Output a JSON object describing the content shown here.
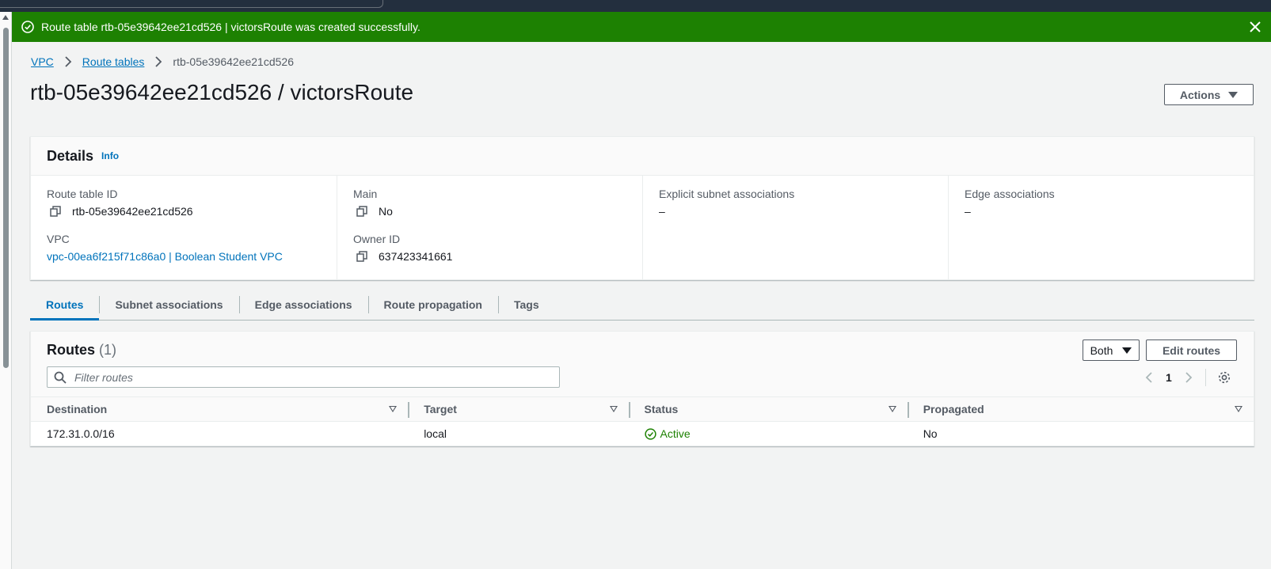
{
  "flash": {
    "message": "Route table rtb-05e39642ee21cd526 | victorsRoute was created successfully.",
    "color": "#1d8102"
  },
  "breadcrumb": {
    "items": [
      "VPC",
      "Route tables"
    ],
    "current": "rtb-05e39642ee21cd526"
  },
  "page": {
    "title": "rtb-05e39642ee21cd526 / victorsRoute",
    "actions_label": "Actions"
  },
  "details": {
    "heading": "Details",
    "info_label": "Info",
    "route_table_id_label": "Route table ID",
    "route_table_id": "rtb-05e39642ee21cd526",
    "vpc_label": "VPC",
    "vpc_value": "vpc-00ea6f215f71c86a0 | Boolean Student VPC",
    "main_label": "Main",
    "main_value": "No",
    "owner_label": "Owner ID",
    "owner_value": "637423341661",
    "explicit_label": "Explicit subnet associations",
    "explicit_value": "–",
    "edge_label": "Edge associations",
    "edge_value": "–"
  },
  "tabs": [
    "Routes",
    "Subnet associations",
    "Edge associations",
    "Route propagation",
    "Tags"
  ],
  "routes": {
    "heading": "Routes",
    "count": "(1)",
    "filter_label": "Both",
    "edit_label": "Edit routes",
    "search_placeholder": "Filter routes",
    "page": "1",
    "columns": [
      "Destination",
      "Target",
      "Status",
      "Propagated"
    ],
    "rows": [
      {
        "destination": "172.31.0.0/16",
        "target": "local",
        "status": "Active",
        "propagated": "No"
      }
    ]
  },
  "colors": {
    "link": "#0073bb",
    "success": "#1d8102",
    "topbar": "#232f3e"
  }
}
